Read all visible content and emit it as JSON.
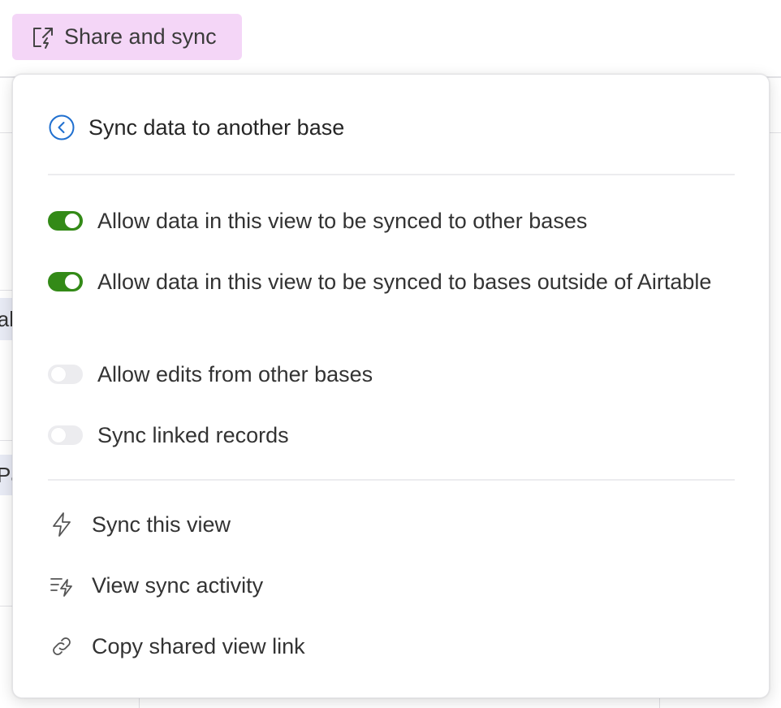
{
  "toolbar": {
    "share_button_label": "Share and sync"
  },
  "background": {
    "cell_1": "al",
    "cell_2": "Pa"
  },
  "popover": {
    "title": "Sync data to another base",
    "toggles": [
      {
        "label": "Allow data in this view to be synced to other bases",
        "enabled": true
      },
      {
        "label": "Allow data in this view to be synced to bases outside of Airtable",
        "enabled": true
      },
      {
        "label": "Allow edits from other bases",
        "enabled": false
      },
      {
        "label": "Sync linked records",
        "enabled": false
      }
    ],
    "actions": [
      {
        "label": "Sync this view",
        "icon": "lightning-icon"
      },
      {
        "label": "View sync activity",
        "icon": "list-lightning-icon"
      },
      {
        "label": "Copy shared view link",
        "icon": "link-icon"
      }
    ]
  },
  "colors": {
    "share_button_bg": "#f4d6f7",
    "toggle_on": "#338a17",
    "toggle_off": "#ececef",
    "back_icon": "#1f6fcf"
  }
}
